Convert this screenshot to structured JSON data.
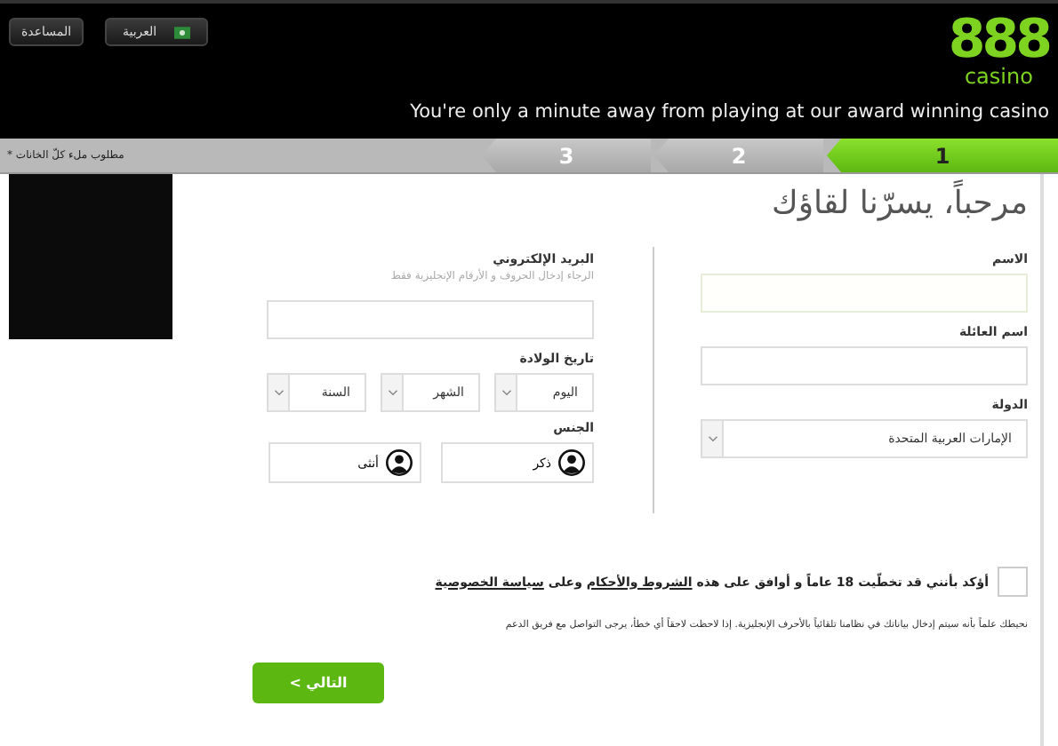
{
  "header": {
    "help_button": "المساعدة",
    "language_button": "العربية",
    "logo": {
      "number": "888",
      "word": "casino"
    },
    "tagline": "You're only a minute away from playing at our award winning casino"
  },
  "steps": [
    {
      "label": "1",
      "selected": true
    },
    {
      "label": "2",
      "selected": false
    },
    {
      "label": "3",
      "selected": false
    }
  ],
  "required_note": "* مطلوب ملء كلّ الخانات",
  "form": {
    "title": "مرحباً، يسرّنا لقاؤك",
    "first_name": {
      "label": "الاسم"
    },
    "last_name": {
      "label": "اسم العائلة"
    },
    "country": {
      "label": "الدولة",
      "value": "الإمارات العربية المتحدة"
    },
    "email": {
      "label": "البريد الإلكتروني",
      "hint": "الرجاء إدخال الحروف و الأرقام الإنجليزية فقط"
    },
    "birth_date": {
      "label": "تاريخ الولادة",
      "selects": [
        "اليوم",
        "الشهر",
        "السنة"
      ]
    },
    "gender": {
      "label": "الجنس",
      "options": [
        {
          "label": "ذكر",
          "selected": false
        },
        {
          "label": "أنثى",
          "selected": false
        }
      ]
    },
    "consent": {
      "checked": false,
      "text_before": "أؤكد بأنني قد تخطّيت 18 عاماً و أوافق على هذه",
      "terms_link": "الشروط والأحكام",
      "text_middle": "وعلى",
      "privacy_link": "سياسة الخصوصية"
    },
    "note": "نحيطك علماً بأنه سيتم إدخال بياناتك في نظامنا تلقائياً بالأحرف الإنجليزية. إذا لاحظت لاحقاً أي خطأ، يرجى التواصل مع فريق الدعم",
    "next_button": "التالي >"
  }
}
